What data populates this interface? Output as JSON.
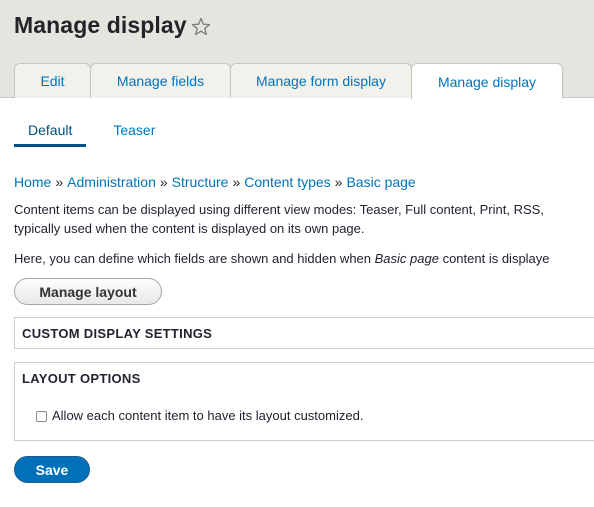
{
  "header": {
    "title": "Manage display",
    "favorite_icon": "star-outline-icon"
  },
  "tabs": [
    {
      "label": "Edit",
      "active": false
    },
    {
      "label": "Manage fields",
      "active": false
    },
    {
      "label": "Manage form display",
      "active": false
    },
    {
      "label": "Manage display",
      "active": true
    }
  ],
  "subtabs": [
    {
      "label": "Default",
      "active": true
    },
    {
      "label": "Teaser",
      "active": false
    }
  ],
  "breadcrumb": {
    "items": [
      "Home",
      "Administration",
      "Structure",
      "Content types",
      "Basic page"
    ],
    "separator": "»"
  },
  "help": {
    "line1": "Content items can be displayed using different view modes: Teaser, Full content, Print, RSS,",
    "line2": "typically used when the content is displayed on its own page.",
    "line3_before": "Here, you can define which fields are shown and hidden when ",
    "line3_em": "Basic page",
    "line3_after": " content is displaye"
  },
  "buttons": {
    "manage_layout": "Manage layout",
    "save": "Save"
  },
  "panels": {
    "custom_display": "CUSTOM DISPLAY SETTINGS",
    "layout_options": "LAYOUT OPTIONS",
    "checkbox_label": "Allow each content item to have its layout customized.",
    "checkbox_checked": false
  },
  "colors": {
    "link": "#0074bd",
    "active_subtab": "#004f80",
    "header_bg": "#e6e4df",
    "save_button": "#0071b8"
  }
}
